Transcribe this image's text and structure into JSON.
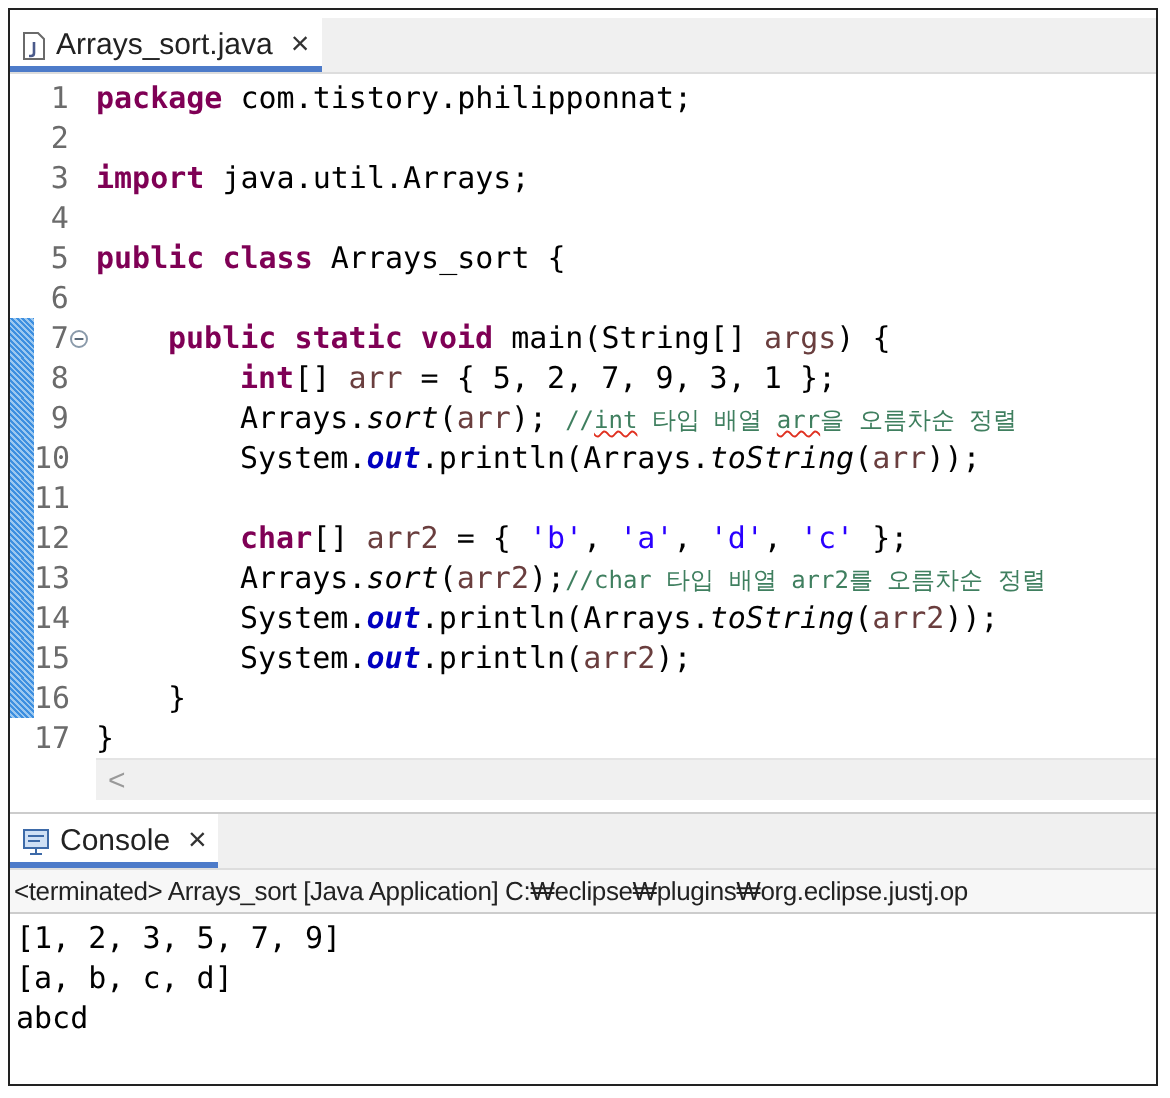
{
  "editor": {
    "tab": {
      "title": "Arrays_sort.java",
      "close": "×",
      "selected": true
    },
    "lines": [
      {
        "number": "1",
        "changed": false,
        "fold": false,
        "tokens": [
          {
            "text": "package",
            "kind": "keyword"
          },
          {
            "text": " com.tistory.philipponnat;",
            "kind": "plain"
          }
        ]
      },
      {
        "number": "2",
        "changed": false,
        "fold": false
      },
      {
        "number": "3",
        "changed": false,
        "fold": false,
        "tokens": [
          {
            "text": "import",
            "kind": "keyword"
          },
          {
            "text": " java.util.Arrays;",
            "kind": "plain"
          }
        ]
      },
      {
        "number": "4",
        "changed": false,
        "fold": false
      },
      {
        "number": "5",
        "changed": false,
        "fold": false,
        "tokens": [
          {
            "text": "public class",
            "kind": "keyword"
          },
          {
            "text": " Arrays_sort {",
            "kind": "plain"
          }
        ],
        "children": [
          {
            "number": "6",
            "changed": false,
            "fold": false
          },
          {
            "number": "7",
            "changed": true,
            "fold": true,
            "tokens": [
              {
                "text": "public static void",
                "kind": "keyword"
              },
              {
                "text": " main(String[] ",
                "kind": "plain"
              },
              {
                "text": "args",
                "kind": "variable"
              },
              {
                "text": ") {",
                "kind": "plain"
              }
            ],
            "children": [
              {
                "number": "8",
                "changed": true,
                "fold": false,
                "tokens": [
                  {
                    "text": "int",
                    "kind": "keyword"
                  },
                  {
                    "text": "[] ",
                    "kind": "plain"
                  },
                  {
                    "text": "arr",
                    "kind": "variable"
                  },
                  {
                    "text": " = { 5, 2, 7, 9, 3, 1 };",
                    "kind": "plain"
                  }
                ]
              },
              {
                "number": "9",
                "changed": true,
                "fold": false,
                "tokens": [
                  {
                    "text": "Arrays.",
                    "kind": "plain"
                  },
                  {
                    "text": "sort",
                    "kind": "method"
                  },
                  {
                    "text": "(",
                    "kind": "plain"
                  },
                  {
                    "text": "arr",
                    "kind": "variable"
                  },
                  {
                    "text": "); ",
                    "kind": "plain"
                  },
                  {
                    "text": "//",
                    "kind": "comment"
                  },
                  {
                    "text": "int",
                    "kind": "typo"
                  },
                  {
                    "text": " 타입 배열 ",
                    "kind": "comment"
                  },
                  {
                    "text": "arr",
                    "kind": "typo"
                  },
                  {
                    "text": "을 오름차순 정렬",
                    "kind": "comment"
                  }
                ]
              },
              {
                "number": "10",
                "changed": true,
                "fold": false,
                "tokens": [
                  {
                    "text": "System.",
                    "kind": "plain"
                  },
                  {
                    "text": "out",
                    "kind": "field"
                  },
                  {
                    "text": ".println(Arrays.",
                    "kind": "plain"
                  },
                  {
                    "text": "toString",
                    "kind": "method"
                  },
                  {
                    "text": "(",
                    "kind": "plain"
                  },
                  {
                    "text": "arr",
                    "kind": "variable"
                  },
                  {
                    "text": "));",
                    "kind": "plain"
                  }
                ]
              },
              {
                "number": "11",
                "changed": true,
                "fold": false
              },
              {
                "number": "12",
                "changed": true,
                "fold": false,
                "tokens": [
                  {
                    "text": "char",
                    "kind": "keyword"
                  },
                  {
                    "text": "[] ",
                    "kind": "plain"
                  },
                  {
                    "text": "arr2",
                    "kind": "variable"
                  },
                  {
                    "text": " = { ",
                    "kind": "plain"
                  },
                  {
                    "text": "'b'",
                    "kind": "string"
                  },
                  {
                    "text": ", ",
                    "kind": "plain"
                  },
                  {
                    "text": "'a'",
                    "kind": "string"
                  },
                  {
                    "text": ", ",
                    "kind": "plain"
                  },
                  {
                    "text": "'d'",
                    "kind": "string"
                  },
                  {
                    "text": ", ",
                    "kind": "plain"
                  },
                  {
                    "text": "'c'",
                    "kind": "string"
                  },
                  {
                    "text": " };",
                    "kind": "plain"
                  }
                ]
              },
              {
                "number": "13",
                "changed": true,
                "fold": false,
                "tokens": [
                  {
                    "text": "Arrays.",
                    "kind": "plain"
                  },
                  {
                    "text": "sort",
                    "kind": "method"
                  },
                  {
                    "text": "(",
                    "kind": "plain"
                  },
                  {
                    "text": "arr2",
                    "kind": "variable"
                  },
                  {
                    "text": ");",
                    "kind": "plain"
                  },
                  {
                    "text": "//char 타입 배열 arr2를 오름차순 정렬",
                    "kind": "comment"
                  }
                ]
              },
              {
                "number": "14",
                "changed": true,
                "fold": false,
                "tokens": [
                  {
                    "text": "System.",
                    "kind": "plain"
                  },
                  {
                    "text": "out",
                    "kind": "field"
                  },
                  {
                    "text": ".println(Arrays.",
                    "kind": "plain"
                  },
                  {
                    "text": "toString",
                    "kind": "method"
                  },
                  {
                    "text": "(",
                    "kind": "plain"
                  },
                  {
                    "text": "arr2",
                    "kind": "variable"
                  },
                  {
                    "text": "));",
                    "kind": "plain"
                  }
                ]
              },
              {
                "number": "15",
                "changed": true,
                "fold": false,
                "tokens": [
                  {
                    "text": "System.",
                    "kind": "plain"
                  },
                  {
                    "text": "out",
                    "kind": "field"
                  },
                  {
                    "text": ".println(",
                    "kind": "plain"
                  },
                  {
                    "text": "arr2",
                    "kind": "variable"
                  },
                  {
                    "text": ");",
                    "kind": "plain"
                  }
                ]
              }
            ]
          },
          {
            "number": "16",
            "changed": true,
            "fold": false,
            "tokens": [
              {
                "text": "}",
                "kind": "plain"
              }
            ]
          }
        ]
      },
      {
        "number": "17",
        "changed": false,
        "fold": false,
        "tokens": [
          {
            "text": "}",
            "kind": "plain"
          }
        ]
      }
    ],
    "scroll_left": "<"
  },
  "console": {
    "tab": {
      "title": "Console",
      "close": "×",
      "selected": true
    },
    "status": "<terminated> Arrays_sort [Java Application] C:₩eclipse₩plugins₩org.eclipse.justj.op",
    "output": [
      "[1, 2, 3, 5, 7, 9]",
      "[a, b, c, d]",
      "abcd"
    ]
  }
}
